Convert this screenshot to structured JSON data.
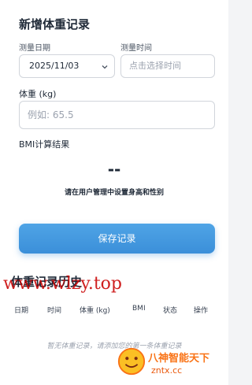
{
  "form": {
    "title": "新增体重记录",
    "date_label": "测量日期",
    "date_value": "2025/11/03",
    "time_label": "测量时间",
    "time_placeholder": "点击选择时间",
    "weight_label": "体重 (kg)",
    "weight_placeholder": "例如: 65.5",
    "bmi_label": "BMI计算结果",
    "bmi_value": "--",
    "bmi_hint": "请在用户管理中设置身高和性别",
    "save_label": "保存记录"
  },
  "history": {
    "title": "体重记录历史",
    "columns": [
      "日期",
      "时间",
      "体重 (kg)",
      "BMI",
      "状态",
      "操作"
    ],
    "empty_text": "暂无体重记录，请添加您的第一条体重记录"
  },
  "watermarks": {
    "site": "www.wlzy.top",
    "badge_line1": "八神智能天下",
    "badge_line2": "zntx.cc"
  },
  "colors": {
    "accent": "#3b8fd9",
    "watermark_red": "#c80000",
    "badge_orange": "#f97316"
  },
  "icons": {
    "date_select": "chevron-down-icon",
    "badge_logo": "smiley-logo-icon"
  }
}
